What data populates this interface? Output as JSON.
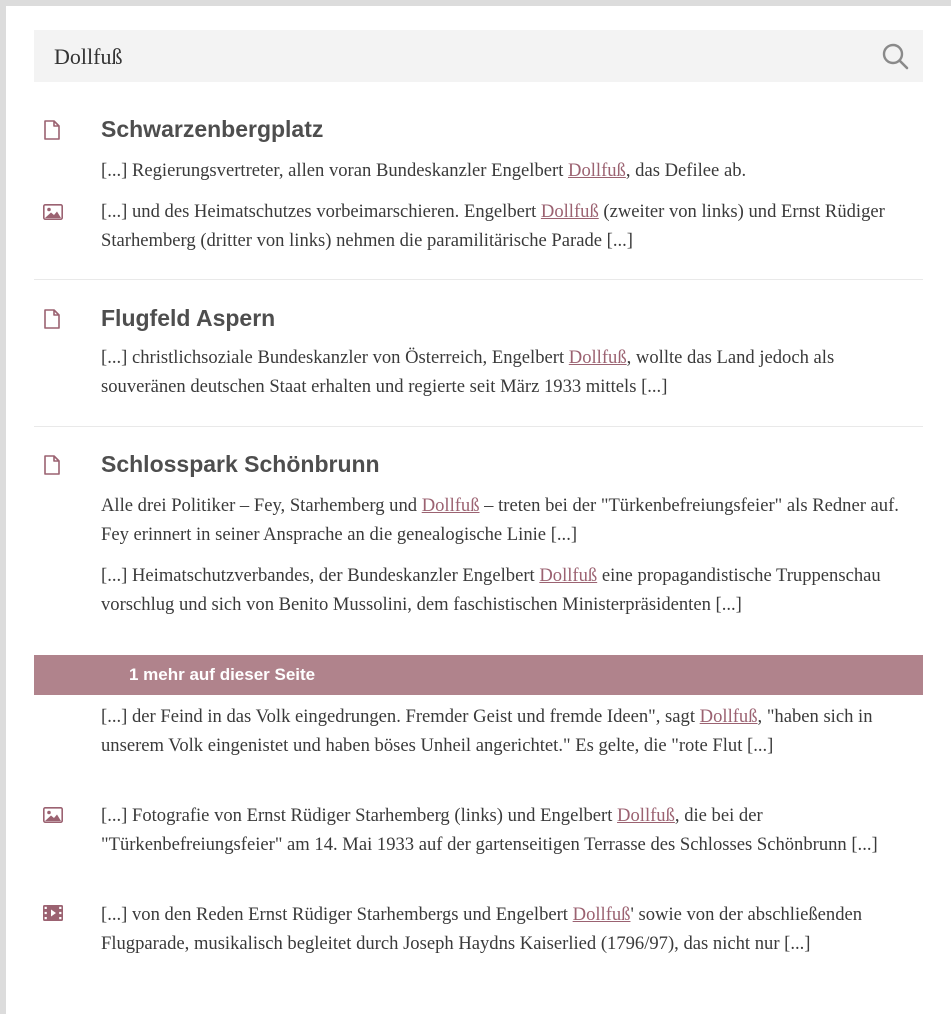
{
  "search": {
    "value": "Dollfuß"
  },
  "more_label": "1 mehr auf dieser Seite",
  "colors": {
    "accent": "#b0838c",
    "highlight": "#9b6271",
    "icon": "#9b6271"
  },
  "results": [
    {
      "title": "Schwarzenbergplatz",
      "snippets": [
        {
          "icon": "document-icon",
          "before": "[...] Regierungsvertreter, allen voran Bundeskanzler Engelbert ",
          "term": "Dollfuß",
          "after": ", das Defilee ab."
        },
        {
          "icon": "image-icon",
          "before": "[...] und des Heimatschutzes vorbeimarschieren. Engelbert ",
          "term": "Dollfuß",
          "after": " (zweiter von links) und Ernst Rüdiger Starhemberg (dritter von links) nehmen die paramilitärische Parade [...]"
        }
      ]
    },
    {
      "title": "Flugfeld Aspern",
      "snippets": [
        {
          "icon": "document-icon",
          "before": "[...] christlichsoziale Bundeskanzler von Österreich, Engelbert ",
          "term": "Dollfuß",
          "after": ", wollte das Land jedoch als souveränen deutschen Staat erhalten und regierte seit März 1933 mittels [...]"
        }
      ]
    },
    {
      "title": "Schlosspark Schönbrunn",
      "snippets": [
        {
          "icon": "document-icon",
          "before": "Alle drei Politiker – Fey, Starhemberg und ",
          "term": "Dollfuß",
          "after": " – treten bei der \"Türkenbefreiungsfeier\" als Redner auf. Fey erinnert in seiner Ansprache an die genealogische Linie [...]"
        },
        {
          "icon": "",
          "before": "[...] Heimatschutzverbandes, der Bundeskanzler Engelbert ",
          "term": "Dollfuß",
          "after": " eine propagandistische Truppenschau vorschlug und sich von Benito Mussolini, dem faschistischen Ministerpräsidenten [...]"
        },
        {
          "icon": "",
          "before": "[...] der Feind in das Volk eingedrungen. Fremder Geist und fremde Ideen\", sagt ",
          "term": "Dollfuß",
          "after": ", \"haben sich in unserem Volk eingenistet und haben böses Unheil angerichtet.\" Es gelte, die \"rote Flut [...]"
        },
        {
          "icon": "image-icon",
          "before": "[...] Fotografie von Ernst Rüdiger Starhemberg (links) und Engelbert ",
          "term": "Dollfuß",
          "after": ", die bei der \"Türkenbefreiungsfeier\" am 14. Mai 1933 auf der gartenseitigen Terrasse des Schlosses Schönbrunn [...]"
        },
        {
          "icon": "video-icon",
          "before": "[...] von den Reden Ernst Rüdiger Starhembergs und Engelbert ",
          "term": "Dollfuß",
          "after": "' sowie von der abschließenden Flugparade, musikalisch begleitet durch Joseph Haydns Kaiserlied (1796/97), das nicht nur [...]"
        }
      ]
    }
  ]
}
